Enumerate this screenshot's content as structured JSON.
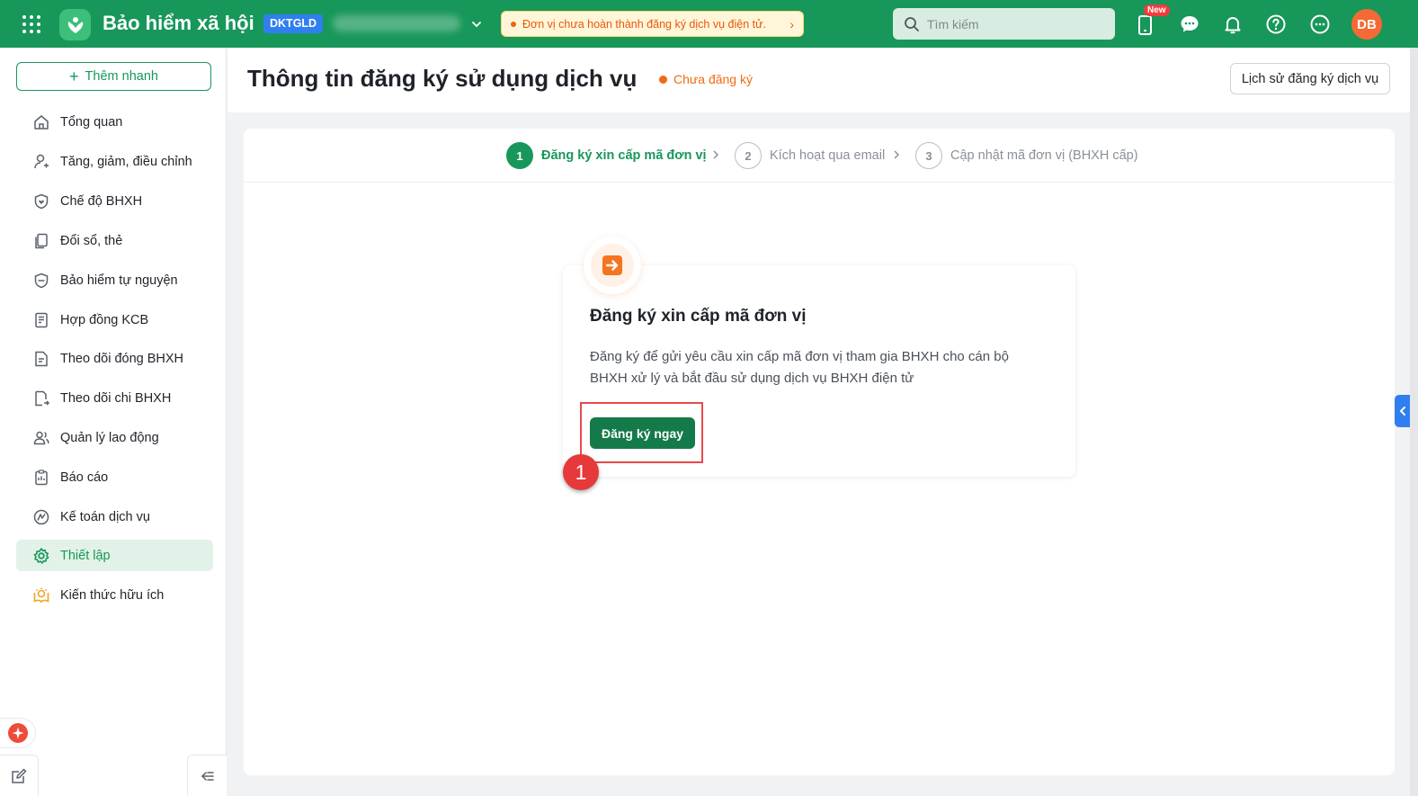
{
  "app": {
    "title": "Bảo hiểm xã hội",
    "unit_badge": "DKTGLD"
  },
  "banner": {
    "text": "Đơn vị chưa hoàn thành đăng ký dịch vụ điện tử.",
    "arrow": "›"
  },
  "search": {
    "placeholder": "Tìm kiếm"
  },
  "topbar": {
    "new_tag": "New",
    "avatar_initials": "DB"
  },
  "sidebar": {
    "quick_add_label": "Thêm nhanh",
    "items": [
      {
        "label": "Tổng quan",
        "icon": "home-icon"
      },
      {
        "label": "Tăng, giảm, điều chỉnh",
        "icon": "user-adjust-icon"
      },
      {
        "label": "Chế độ BHXH",
        "icon": "shield-heart-icon"
      },
      {
        "label": "Đổi sổ, thẻ",
        "icon": "documents-icon"
      },
      {
        "label": "Bảo hiểm tự nguyện",
        "icon": "shield-icon"
      },
      {
        "label": "Hợp đồng KCB",
        "icon": "contract-icon"
      },
      {
        "label": "Theo dõi đóng BHXH",
        "icon": "tracking-icon"
      },
      {
        "label": "Theo dõi chi BHXH",
        "icon": "payout-icon"
      },
      {
        "label": "Quản lý lao động",
        "icon": "users-icon"
      },
      {
        "label": "Báo cáo",
        "icon": "report-icon"
      },
      {
        "label": "Kế toán dịch vụ",
        "icon": "accounting-icon"
      },
      {
        "label": "Thiết lập",
        "icon": "gear-icon",
        "active": true
      },
      {
        "label": "Kiến thức hữu ích",
        "icon": "knowledge-icon"
      }
    ]
  },
  "header": {
    "title": "Thông tin đăng ký sử dụng dịch vụ",
    "status": "Chưa đăng ký",
    "history_button": "Lịch sử đăng ký dịch vụ"
  },
  "stepper": {
    "steps": [
      {
        "number": "1",
        "label": "Đăng ký xin cấp mã đơn vị",
        "state": "active"
      },
      {
        "number": "2",
        "label": "Kích hoạt qua email",
        "state": "inactive"
      },
      {
        "number": "3",
        "label": "Cập nhật mã đơn vị (BHXH cấp)",
        "state": "inactive"
      }
    ]
  },
  "register_card": {
    "title": "Đăng ký xin cấp mã đơn vị",
    "description": "Đăng ký để gửi yêu cầu xin cấp mã đơn vị tham gia BHXH cho cán bộ BHXH xử lý và bắt đầu sử dụng dịch vụ BHXH điện tử",
    "button_label": "Đăng ký ngay"
  },
  "annotation": {
    "marker_number": "1"
  },
  "colors": {
    "brand_green": "#18975a",
    "button_green": "#157a4a",
    "warning_orange": "#f06a13",
    "accent_blue": "#2f7ff0",
    "highlight_red": "#e84a4a"
  }
}
